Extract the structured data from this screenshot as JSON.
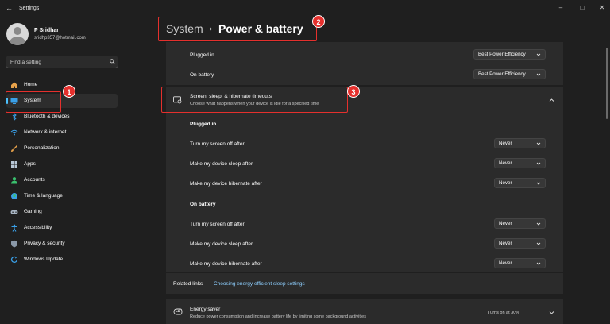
{
  "window": {
    "title": "Settings"
  },
  "profile": {
    "name": "P Sridhar",
    "email": "sridhp357@hotmail.com"
  },
  "search": {
    "placeholder": "Find a setting"
  },
  "nav": [
    {
      "label": "Home",
      "icon": "home-icon"
    },
    {
      "label": "System",
      "icon": "system-icon",
      "active": true
    },
    {
      "label": "Bluetooth & devices",
      "icon": "bluetooth-icon"
    },
    {
      "label": "Network & internet",
      "icon": "wifi-icon"
    },
    {
      "label": "Personalization",
      "icon": "brush-icon"
    },
    {
      "label": "Apps",
      "icon": "apps-icon"
    },
    {
      "label": "Accounts",
      "icon": "accounts-icon"
    },
    {
      "label": "Time & language",
      "icon": "globe-icon"
    },
    {
      "label": "Gaming",
      "icon": "gamepad-icon"
    },
    {
      "label": "Accessibility",
      "icon": "accessibility-icon"
    },
    {
      "label": "Privacy & security",
      "icon": "shield-icon"
    },
    {
      "label": "Windows Update",
      "icon": "update-icon"
    }
  ],
  "breadcrumb": {
    "parent": "System",
    "separator": "›",
    "current": "Power & battery"
  },
  "power_mode": {
    "rows": [
      {
        "label": "Plugged in",
        "value": "Best Power Efficiency"
      },
      {
        "label": "On battery",
        "value": "Best Power Efficiency"
      }
    ]
  },
  "timeouts": {
    "title": "Screen, sleep, & hibernate timeouts",
    "description": "Choose what happens when your device is idle for a specified time",
    "plugged_in": {
      "heading": "Plugged in",
      "rows": [
        {
          "label": "Turn my screen off after",
          "value": "Never"
        },
        {
          "label": "Make my device sleep after",
          "value": "Never"
        },
        {
          "label": "Make my device hibernate after",
          "value": "Never"
        }
      ]
    },
    "on_battery": {
      "heading": "On battery",
      "rows": [
        {
          "label": "Turn my screen off after",
          "value": "Never"
        },
        {
          "label": "Make my device sleep after",
          "value": "Never"
        },
        {
          "label": "Make my device hibernate after",
          "value": "Never"
        }
      ]
    }
  },
  "related_links": {
    "label": "Related links",
    "link": "Choosing energy efficient sleep settings"
  },
  "energy_saver": {
    "title": "Energy saver",
    "description": "Reduce power consumption and increase battery life by limiting some background activities",
    "status": "Turns on at 30%"
  },
  "annotations": [
    "1",
    "2",
    "3"
  ],
  "colors": {
    "accent": "#4cc2ff",
    "annotation": "#e5302d",
    "background": "#1f1f1f",
    "card": "#2b2b2b",
    "link": "#8ecfff"
  }
}
